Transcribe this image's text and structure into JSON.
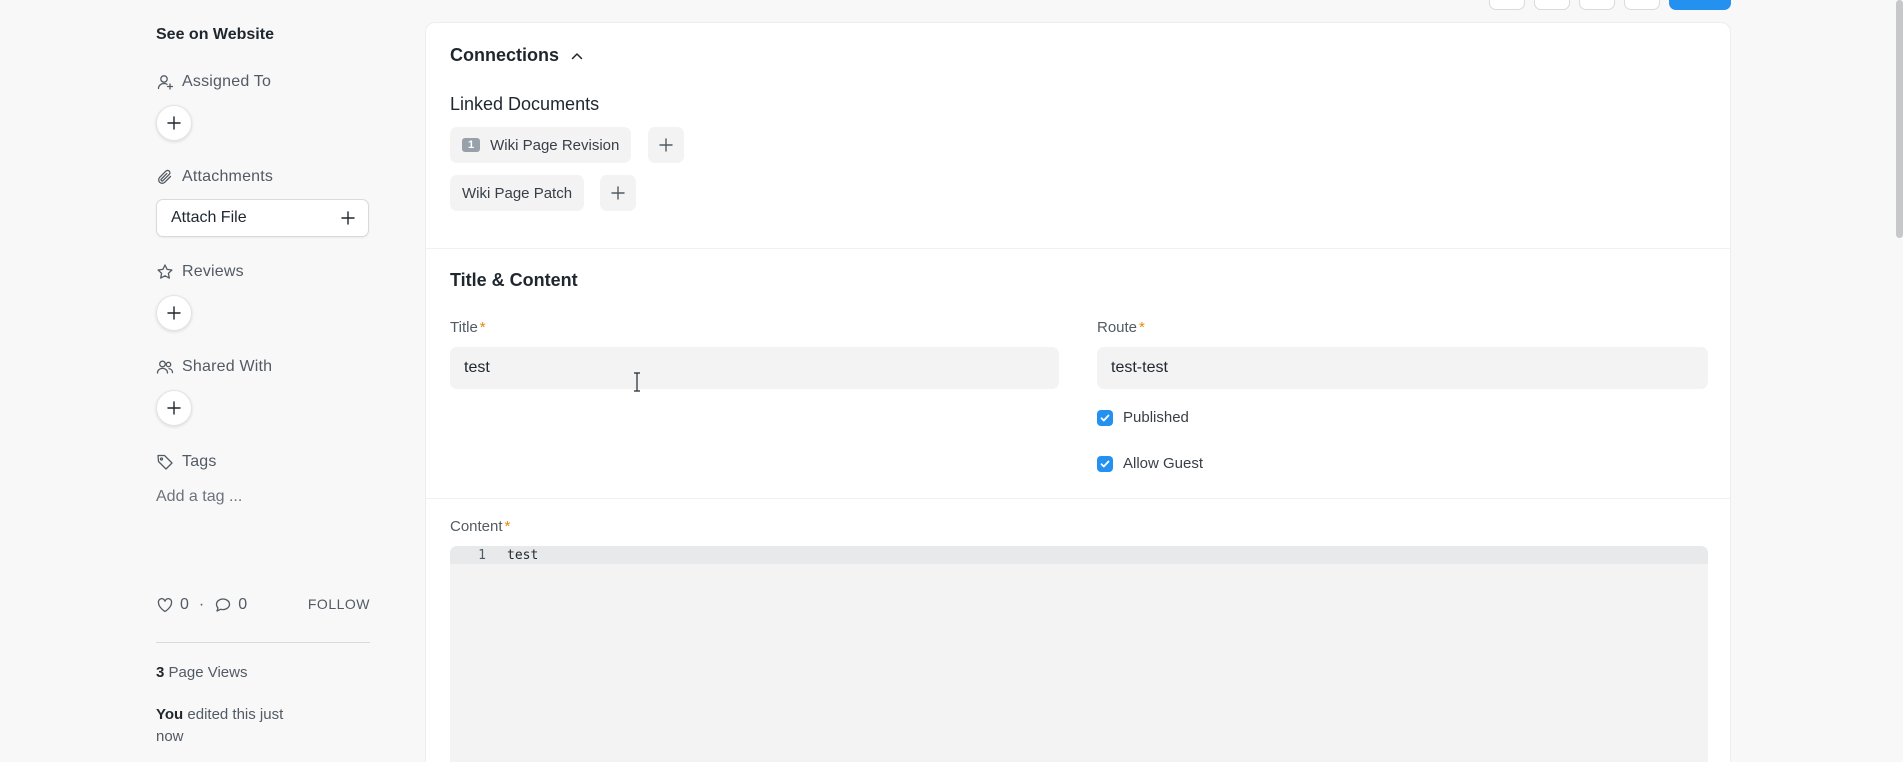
{
  "sidebar": {
    "see_on_website": "See on Website",
    "assigned_to": "Assigned To",
    "attachments": "Attachments",
    "attach_file": "Attach File",
    "reviews": "Reviews",
    "shared_with": "Shared With",
    "tags": "Tags",
    "add_tag": "Add a tag ...",
    "likes_count": "0",
    "separator": "·",
    "comments_count": "0",
    "follow": "FOLLOW",
    "page_views_count": "3",
    "page_views_label": "Page Views",
    "edited_by": "You",
    "edited_text": "edited this just now"
  },
  "connections": {
    "title": "Connections",
    "linked_documents": "Linked Documents",
    "links": [
      {
        "count": "1",
        "label": "Wiki Page Revision"
      },
      {
        "label": "Wiki Page Patch"
      }
    ]
  },
  "title_content": {
    "heading": "Title & Content",
    "title_label": "Title",
    "title_value": "test",
    "route_label": "Route",
    "route_value": "test-test",
    "required_mark": "*",
    "published_label": "Published",
    "allow_guest_label": "Allow Guest",
    "content_label": "Content",
    "editor_line_number": "1",
    "editor_line_text": "test"
  },
  "colors": {
    "primary": "#2490ef",
    "required": "#e8870e"
  }
}
